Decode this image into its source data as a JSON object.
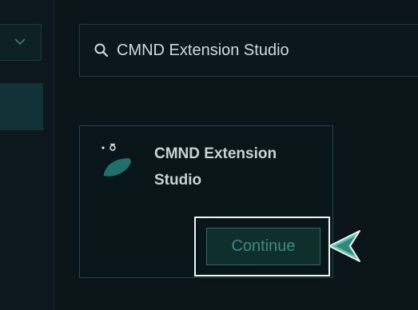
{
  "search": {
    "value": "CMND Extension Studio",
    "icon": "search-icon"
  },
  "sidebar": {
    "dropdown_icon": "chevron-down-icon"
  },
  "extension_card": {
    "title": "CMND Extension Studio",
    "icon": "cmnd-logo-icon",
    "continue_label": "Continue"
  },
  "colors": {
    "background": "#0a1419",
    "accent": "#3e8a80",
    "logo": "#1f6f6a",
    "highlight": "#f2f5f5",
    "pointer": "#4fb8a6"
  }
}
